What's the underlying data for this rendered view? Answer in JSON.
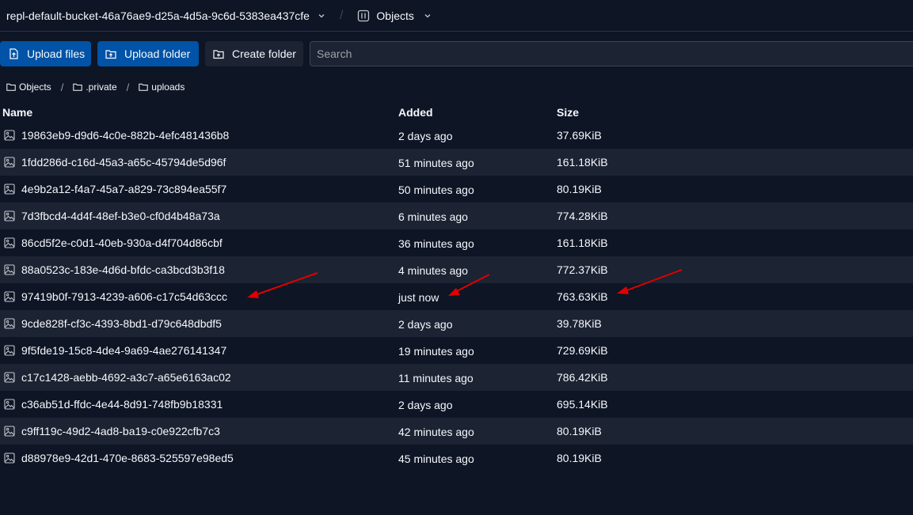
{
  "topbar": {
    "bucket_name": "repl-default-bucket-46a76ae9-d25a-4d5a-9c6d-5383ea437cfe",
    "view_label": "Objects"
  },
  "toolbar": {
    "upload_files_label": "Upload files",
    "upload_folder_label": "Upload folder",
    "create_folder_label": "Create folder",
    "search_placeholder": "Search"
  },
  "breadcrumb": [
    "Objects",
    ".private",
    "uploads"
  ],
  "table": {
    "columns": [
      "Name",
      "Added",
      "Size"
    ],
    "rows": [
      {
        "name": "19863eb9-d9d6-4c0e-882b-4efc481436b8",
        "added": "2 days ago",
        "size": "37.69KiB"
      },
      {
        "name": "1fdd286d-c16d-45a3-a65c-45794de5d96f",
        "added": "51 minutes ago",
        "size": "161.18KiB"
      },
      {
        "name": "4e9b2a12-f4a7-45a7-a829-73c894ea55f7",
        "added": "50 minutes ago",
        "size": "80.19KiB"
      },
      {
        "name": "7d3fbcd4-4d4f-48ef-b3e0-cf0d4b48a73a",
        "added": "6 minutes ago",
        "size": "774.28KiB"
      },
      {
        "name": "86cd5f2e-c0d1-40eb-930a-d4f704d86cbf",
        "added": "36 minutes ago",
        "size": "161.18KiB"
      },
      {
        "name": "88a0523c-183e-4d6d-bfdc-ca3bcd3b3f18",
        "added": "4 minutes ago",
        "size": "772.37KiB"
      },
      {
        "name": "97419b0f-7913-4239-a606-c17c54d63ccc",
        "added": "just now",
        "size": "763.63KiB"
      },
      {
        "name": "9cde828f-cf3c-4393-8bd1-d79c648dbdf5",
        "added": "2 days ago",
        "size": "39.78KiB"
      },
      {
        "name": "9f5fde19-15c8-4de4-9a69-4ae276141347",
        "added": "19 minutes ago",
        "size": "729.69KiB"
      },
      {
        "name": "c17c1428-aebb-4692-a3c7-a65e6163ac02",
        "added": "11 minutes ago",
        "size": "786.42KiB"
      },
      {
        "name": "c36ab51d-ffdc-4e44-8d91-748fb9b18331",
        "added": "2 days ago",
        "size": "695.14KiB"
      },
      {
        "name": "c9ff119c-49d2-4ad8-ba19-c0e922cfb7c3",
        "added": "42 minutes ago",
        "size": "80.19KiB"
      },
      {
        "name": "d88978e9-42d1-470e-8683-525597e98ed5",
        "added": "45 minutes ago",
        "size": "80.19KiB"
      }
    ]
  },
  "annotation": {
    "arrow_color": "#e00000"
  },
  "colors": {
    "background": "#0e1525",
    "row_alt": "#1c2333",
    "primary_button": "#0053a6"
  },
  "icons": {
    "bucket_chevron": "chevron-down-icon",
    "objects": "objects-icon",
    "upload": "upload-icon",
    "folder_plus": "folder-plus-icon",
    "folder": "folder-icon",
    "file": "image-file-icon"
  }
}
